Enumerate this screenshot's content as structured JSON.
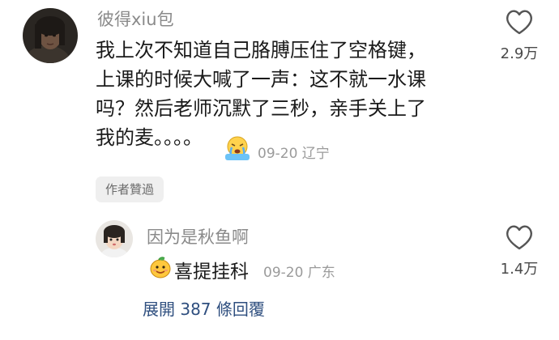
{
  "comment": {
    "username": "彼得xiu包",
    "lines": [
      "我上次不知道自己胳膊压住了空格键，",
      "上课的时候大喊了一声：这不就一水课",
      "吗？然后老师沉默了三秒，亲手关上了",
      "我的麦。。。。"
    ],
    "emoji_icon": "crying-emoji-icon",
    "meta": "09-20 辽宁",
    "badge": "作者贊過",
    "like_count": "2.9万"
  },
  "reply": {
    "username": "因为是秋鱼啊",
    "emoji_icon": "mango-face-emoji-icon",
    "text": "喜提挂科",
    "meta": "09-20 广东",
    "like_count": "1.4万"
  },
  "expand_label": "展開 387 條回覆",
  "colors": {
    "link": "#2f4f7f",
    "muted": "#9b9b9b",
    "badge_bg": "#efefef"
  }
}
